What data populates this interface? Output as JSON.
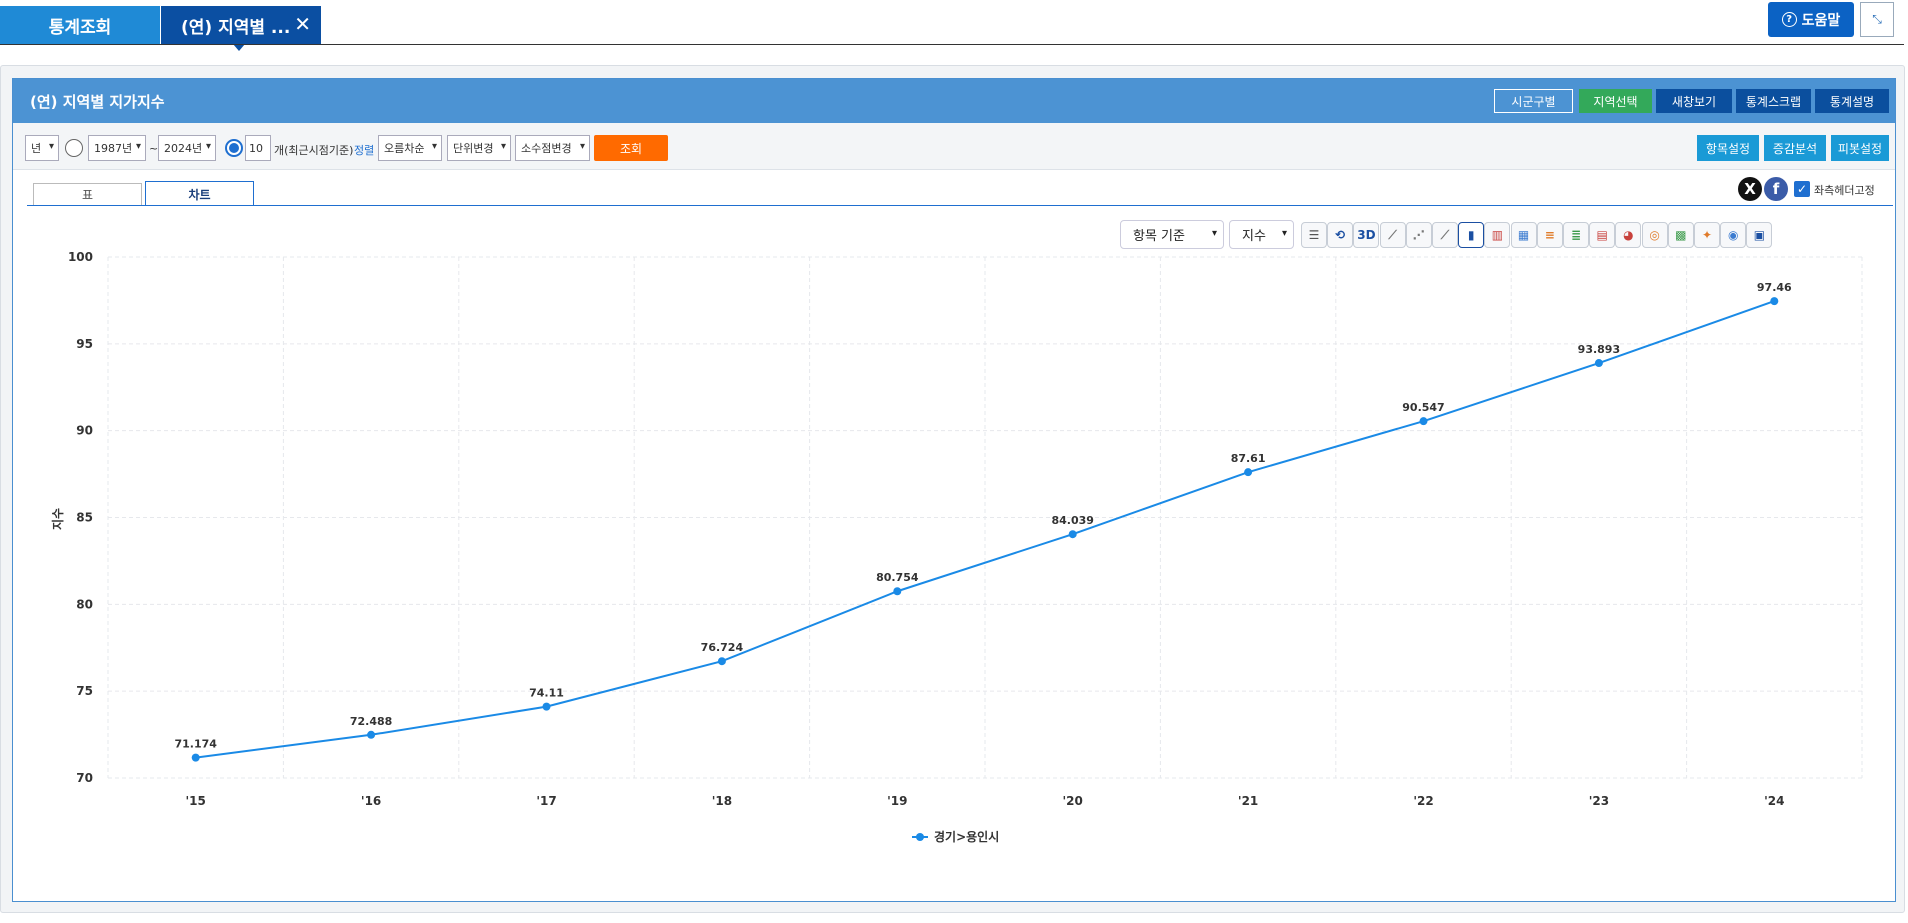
{
  "top_tabs": {
    "home": "통계조회",
    "current": "(연) 지역별 ...",
    "close": "✕"
  },
  "help": {
    "label": "도움말",
    "icon": "question-circle-icon"
  },
  "shrink": {
    "icon": "collapse-arrows-icon",
    "glyph": "⤡"
  },
  "panel": {
    "title": "(연) 지역별 지가지수",
    "buttons": {
      "sigun": "시군구별",
      "region": "지역선택",
      "new_window": "새창보기",
      "scrap": "통계스크랩",
      "desc": "통계설명"
    }
  },
  "controls": {
    "period": "년",
    "from_year": "1987년",
    "tilde": "~",
    "to_year": "2024년",
    "count": "10",
    "count_suffix": "개(최근시점기준)",
    "sort_label": "정렬",
    "sort_order": "오름차순",
    "unit_change": "단위변경",
    "decimal_change": "소수점변경",
    "search": "조회",
    "item_setting": "항목설정",
    "change_analysis": "증감분석",
    "pivot_setting": "피봇설정"
  },
  "subtabs": {
    "table": "표",
    "chart": "차트"
  },
  "social": {
    "x": "X",
    "facebook": "f"
  },
  "fix_header": {
    "label": "좌측헤더고정",
    "checked": true
  },
  "chart_toolbar": {
    "basis": "항목 기준",
    "measure": "지수",
    "icons": [
      "list-icon",
      "rotate-icon",
      "3d-icon",
      "line-chart-icon",
      "scatter-chart-icon",
      "line-area-icon",
      "bar-chart-icon",
      "stacked-bar-icon",
      "bar-percent-icon",
      "horizontal-bar-icon",
      "horizontal-stacked-bar-icon",
      "horizontal-bar-percent-icon",
      "pie-chart-icon",
      "donut-chart-icon",
      "treemap-icon",
      "radar-chart-icon",
      "dartboard-chart-icon",
      "save-icon"
    ],
    "label_3d": "3D",
    "active_index": 6
  },
  "colors": {
    "series": "#1a8ae6",
    "search_button": "#ff6a00",
    "header": "#4c93d3"
  },
  "chart_data": {
    "type": "line",
    "x": [
      "'15",
      "'16",
      "'17",
      "'18",
      "'19",
      "'20",
      "'21",
      "'22",
      "'23",
      "'24"
    ],
    "series": [
      {
        "name": "경기>용인시",
        "values": [
          71.174,
          72.488,
          74.11,
          76.724,
          80.754,
          84.039,
          87.61,
          90.547,
          93.893,
          97.46
        ]
      }
    ],
    "ylabel": "지수",
    "yticks": [
      70,
      75,
      80,
      85,
      90,
      95,
      100
    ],
    "ylim": [
      70,
      100
    ],
    "grid": true,
    "legend": "bottom-center"
  }
}
